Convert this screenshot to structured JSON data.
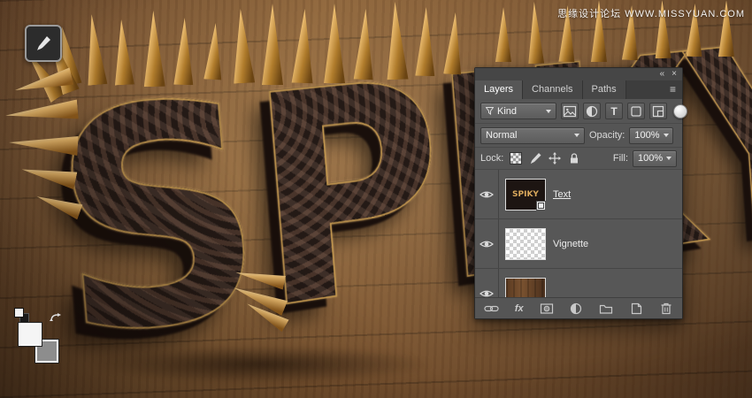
{
  "watermark": {
    "text": "思缘设计论坛 WWW.MISSYUAN.COM"
  },
  "artwork": {
    "word": "SPIKY"
  },
  "panel": {
    "header": {
      "collapse_icon": "«",
      "close_icon": "×",
      "menu_icon": "≡"
    },
    "tabs": [
      {
        "label": "Layers"
      },
      {
        "label": "Channels"
      },
      {
        "label": "Paths"
      }
    ],
    "filter": {
      "kind": "Kind",
      "type_icon": "T"
    },
    "blend": {
      "mode": "Normal",
      "opacity_label": "Opacity:",
      "opacity": "100%"
    },
    "lock": {
      "label": "Lock:",
      "fill_label": "Fill:",
      "fill": "100%"
    },
    "layers": [
      {
        "name": "Text"
      },
      {
        "name": "Vignette"
      },
      {
        "name": ""
      }
    ],
    "footer": {
      "fx": "fx"
    }
  }
}
